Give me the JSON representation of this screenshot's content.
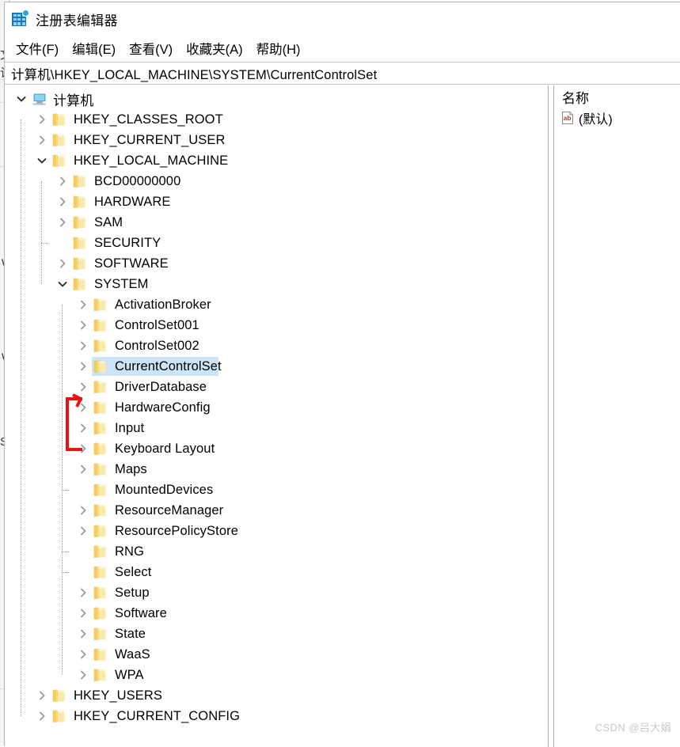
{
  "window": {
    "title": "注册表编辑器",
    "app_icon": "registry-editor-icon"
  },
  "menu": {
    "items": [
      {
        "label": "文件(F)",
        "name": "menu-file"
      },
      {
        "label": "编辑(E)",
        "name": "menu-edit"
      },
      {
        "label": "查看(V)",
        "name": "menu-view"
      },
      {
        "label": "收藏夹(A)",
        "name": "menu-favorites"
      },
      {
        "label": "帮助(H)",
        "name": "menu-help"
      }
    ]
  },
  "address": {
    "path": "计算机\\HKEY_LOCAL_MACHINE\\SYSTEM\\CurrentControlSet"
  },
  "tree": {
    "nodes": [
      {
        "label": "计算机",
        "depth": 0,
        "twisty": "expanded",
        "icon": "computer-icon",
        "selected": false,
        "cn": true
      },
      {
        "label": "HKEY_CLASSES_ROOT",
        "depth": 1,
        "twisty": "collapsed",
        "icon": "folder-icon",
        "selected": false
      },
      {
        "label": "HKEY_CURRENT_USER",
        "depth": 1,
        "twisty": "collapsed",
        "icon": "folder-icon",
        "selected": false
      },
      {
        "label": "HKEY_LOCAL_MACHINE",
        "depth": 1,
        "twisty": "expanded",
        "icon": "folder-icon",
        "selected": false
      },
      {
        "label": "BCD00000000",
        "depth": 2,
        "twisty": "collapsed",
        "icon": "folder-icon",
        "selected": false
      },
      {
        "label": "HARDWARE",
        "depth": 2,
        "twisty": "collapsed",
        "icon": "folder-icon",
        "selected": false
      },
      {
        "label": "SAM",
        "depth": 2,
        "twisty": "collapsed",
        "icon": "folder-icon",
        "selected": false
      },
      {
        "label": "SECURITY",
        "depth": 2,
        "twisty": "none",
        "icon": "folder-icon",
        "selected": false
      },
      {
        "label": "SOFTWARE",
        "depth": 2,
        "twisty": "collapsed",
        "icon": "folder-icon",
        "selected": false
      },
      {
        "label": "SYSTEM",
        "depth": 2,
        "twisty": "expanded",
        "icon": "folder-icon",
        "selected": false
      },
      {
        "label": "ActivationBroker",
        "depth": 3,
        "twisty": "collapsed",
        "icon": "folder-icon",
        "selected": false
      },
      {
        "label": "ControlSet001",
        "depth": 3,
        "twisty": "collapsed",
        "icon": "folder-icon",
        "selected": false
      },
      {
        "label": "ControlSet002",
        "depth": 3,
        "twisty": "collapsed",
        "icon": "folder-icon",
        "selected": false
      },
      {
        "label": "CurrentControlSet",
        "depth": 3,
        "twisty": "collapsed",
        "icon": "folder-icon",
        "selected": true
      },
      {
        "label": "DriverDatabase",
        "depth": 3,
        "twisty": "collapsed",
        "icon": "folder-icon",
        "selected": false
      },
      {
        "label": "HardwareConfig",
        "depth": 3,
        "twisty": "collapsed",
        "icon": "folder-icon",
        "selected": false
      },
      {
        "label": "Input",
        "depth": 3,
        "twisty": "collapsed",
        "icon": "folder-icon",
        "selected": false
      },
      {
        "label": "Keyboard Layout",
        "depth": 3,
        "twisty": "collapsed",
        "icon": "folder-icon",
        "selected": false
      },
      {
        "label": "Maps",
        "depth": 3,
        "twisty": "collapsed",
        "icon": "folder-icon",
        "selected": false
      },
      {
        "label": "MountedDevices",
        "depth": 3,
        "twisty": "none",
        "icon": "folder-icon",
        "selected": false
      },
      {
        "label": "ResourceManager",
        "depth": 3,
        "twisty": "collapsed",
        "icon": "folder-icon",
        "selected": false
      },
      {
        "label": "ResourcePolicyStore",
        "depth": 3,
        "twisty": "collapsed",
        "icon": "folder-icon",
        "selected": false
      },
      {
        "label": "RNG",
        "depth": 3,
        "twisty": "none",
        "icon": "folder-icon",
        "selected": false
      },
      {
        "label": "Select",
        "depth": 3,
        "twisty": "none",
        "icon": "folder-icon",
        "selected": false
      },
      {
        "label": "Setup",
        "depth": 3,
        "twisty": "collapsed",
        "icon": "folder-icon",
        "selected": false
      },
      {
        "label": "Software",
        "depth": 3,
        "twisty": "collapsed",
        "icon": "folder-icon",
        "selected": false
      },
      {
        "label": "State",
        "depth": 3,
        "twisty": "collapsed",
        "icon": "folder-icon",
        "selected": false
      },
      {
        "label": "WaaS",
        "depth": 3,
        "twisty": "collapsed",
        "icon": "folder-icon",
        "selected": false
      },
      {
        "label": "WPA",
        "depth": 3,
        "twisty": "collapsed",
        "icon": "folder-icon",
        "selected": false
      },
      {
        "label": "HKEY_USERS",
        "depth": 1,
        "twisty": "collapsed",
        "icon": "folder-icon",
        "selected": false
      },
      {
        "label": "HKEY_CURRENT_CONFIG",
        "depth": 1,
        "twisty": "collapsed",
        "icon": "folder-icon",
        "selected": false
      }
    ]
  },
  "annotation": {
    "color": "#ee1111",
    "shape": "bracket-arrow-up",
    "target_node": "CurrentControlSet"
  },
  "values_pane": {
    "column_header": "名称",
    "rows": [
      {
        "name": "(默认)",
        "icon": "string-value-icon"
      }
    ]
  },
  "background_window": {
    "fragments": [
      "S",
      "文",
      "计算",
      "∨",
      "∨",
      "S"
    ]
  },
  "watermark": {
    "text": "CSDN @吕大娟"
  },
  "colors": {
    "selection": "#cce4f7",
    "folder_body": "#fce8a8",
    "folder_tab": "#f5cd5a",
    "annotation": "#ee1111",
    "chevron": "#9c9c9c",
    "watermark": "#c8c8c8"
  }
}
